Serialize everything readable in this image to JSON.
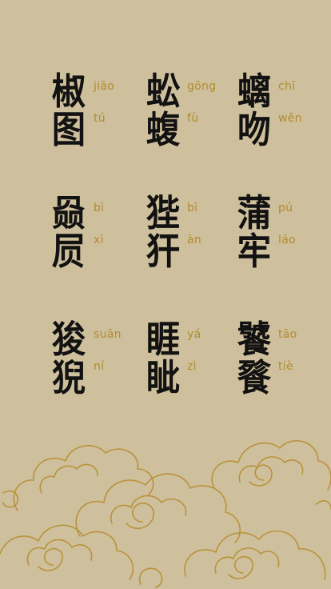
{
  "creatures": [
    {
      "chars": [
        "椒",
        "图"
      ],
      "pinyin": [
        "jiāo",
        "tú"
      ]
    },
    {
      "chars": [
        "蚣",
        "蝮"
      ],
      "pinyin": [
        "gōng",
        "fù"
      ]
    },
    {
      "chars": [
        "螭",
        "吻"
      ],
      "pinyin": [
        "chī",
        "wěn"
      ]
    },
    {
      "chars": [
        "赑",
        "屃"
      ],
      "pinyin": [
        "bì",
        "xì"
      ]
    },
    {
      "chars": [
        "狴",
        "犴"
      ],
      "pinyin": [
        "bì",
        "àn"
      ]
    },
    {
      "chars": [
        "蒲",
        "牢"
      ],
      "pinyin": [
        "pú",
        "láo"
      ]
    },
    {
      "chars": [
        "狻",
        "猊"
      ],
      "pinyin": [
        "suān",
        "ní"
      ]
    },
    {
      "chars": [
        "睚",
        "眦"
      ],
      "pinyin": [
        "yá",
        "zì"
      ]
    },
    {
      "chars": [
        "饕",
        "餮"
      ],
      "pinyin": [
        "tāo",
        "tiè"
      ]
    }
  ],
  "colors": {
    "background": "#cfc09d",
    "ink": "#131212",
    "gold": "#b08b2e",
    "cloud_line": "#b8923a"
  },
  "decoration": "auspicious-cloud-pattern"
}
